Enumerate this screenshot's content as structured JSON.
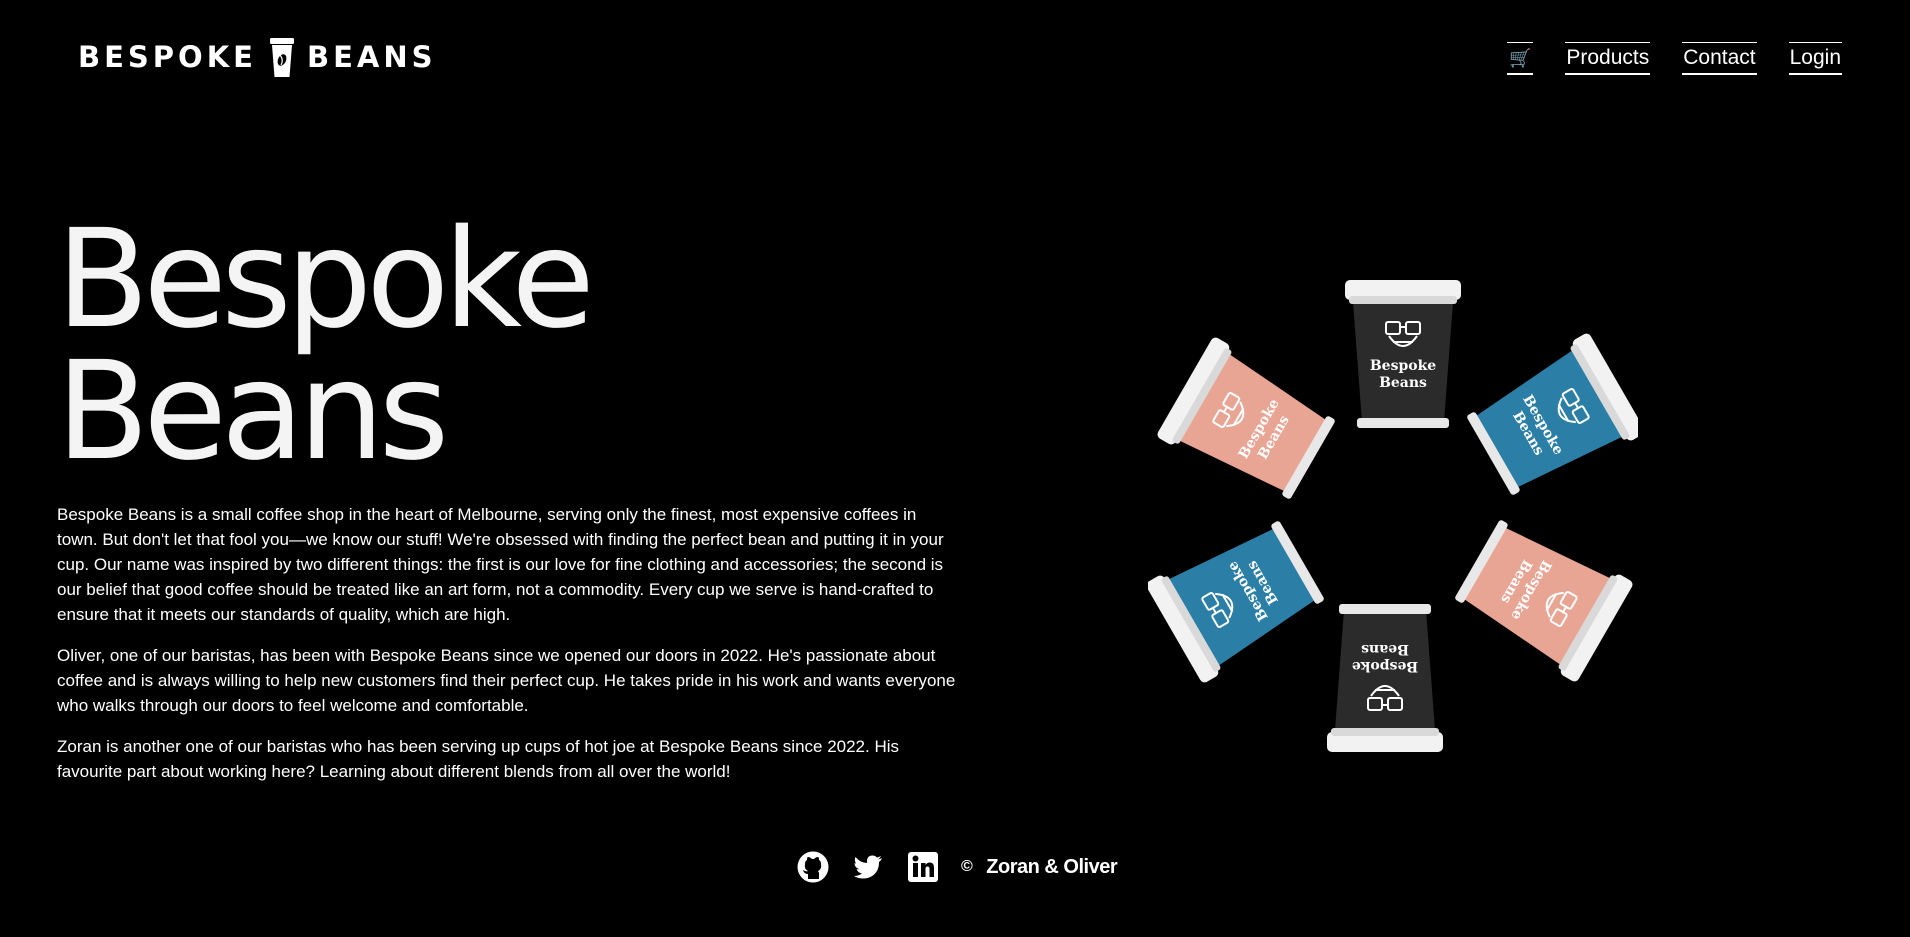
{
  "header": {
    "logo_left": "BESPOKE",
    "logo_right": "BEANS",
    "nav": {
      "cart_icon": "🛒",
      "products": "Products",
      "contact": "Contact",
      "login": "Login"
    }
  },
  "hero": {
    "title_line1": "Bespoke",
    "title_line2": "Beans"
  },
  "content": {
    "paragraphs": [
      "Bespoke Beans is a small coffee shop in the heart of Melbourne, serving only the finest, most expensive coffees in town. But don't let that fool you—we know our stuff! We're obsessed with finding the perfect bean and putting it in your cup. Our name was inspired by two different things: the first is our love for fine clothing and accessories; the second is our belief that good coffee should be treated like an art form, not a commodity. Every cup we serve is hand-crafted to ensure that it meets our standards of quality, which are high.",
      "Oliver, one of our baristas, has been with Bespoke Beans since we opened our doors in 2022. He's passionate about coffee and is always willing to help new customers find their perfect cup. He takes pride in his work and wants everyone who walks through our doors to feel welcome and comfortable.",
      "Zoran is another one of our baristas who has been serving up cups of hot joe at Bespoke Beans since 2022. His favourite part about working here? Learning about different blends from all over the world!"
    ]
  },
  "cups": {
    "label_line1": "Bespoke",
    "label_line2": "Beans",
    "colors": {
      "dark": "#2b2b2b",
      "pink": "#e9a594",
      "blue": "#2b7ea6",
      "lid": "#f2f2f2"
    }
  },
  "footer": {
    "icons": [
      "github-icon",
      "twitter-icon",
      "linkedin-icon"
    ],
    "copyright_symbol": "©",
    "copyright_text": "Zoran & Oliver"
  }
}
